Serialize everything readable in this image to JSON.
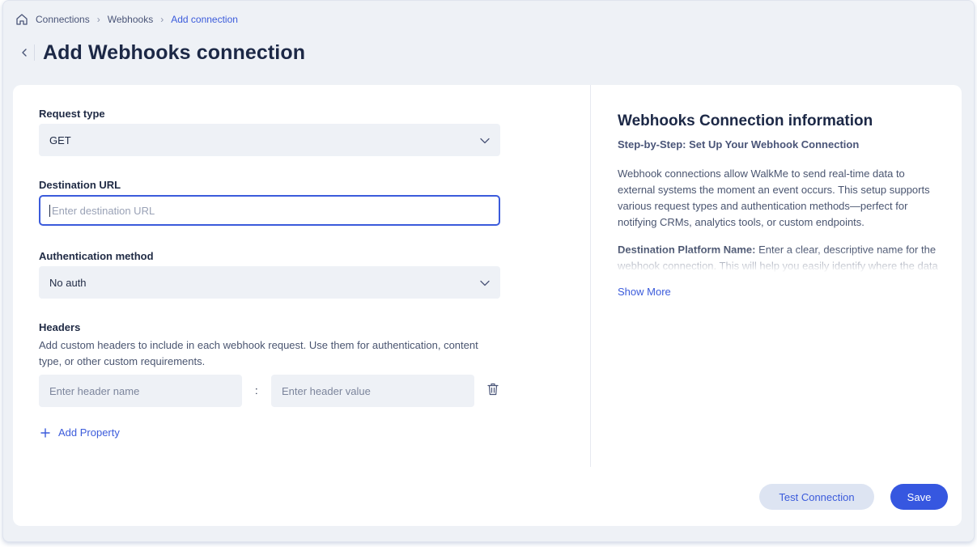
{
  "breadcrumb": {
    "items": [
      "Connections",
      "Webhooks",
      "Add connection"
    ]
  },
  "header": {
    "title": "Add Webhooks connection"
  },
  "form": {
    "request_type": {
      "label": "Request type",
      "value": "GET"
    },
    "destination_url": {
      "label": "Destination URL",
      "placeholder": "Enter destination URL"
    },
    "auth_method": {
      "label": "Authentication method",
      "value": "No auth"
    },
    "headers": {
      "label": "Headers",
      "help": "Add custom headers to include in each webhook request. Use them for authentication, content type, or other custom requirements.",
      "name_placeholder": "Enter header name",
      "separator": ":",
      "value_placeholder": "Enter header value"
    },
    "add_property_label": "Add Property"
  },
  "info": {
    "title": "Webhooks Connection information",
    "subtitle": "Step-by-Step: Set Up Your Webhook Connection",
    "paragraph": "Webhook connections allow WalkMe to send real-time data to external systems the moment an event occurs. This setup supports various request types and authentication methods—perfect for notifying CRMs, analytics tools, or custom endpoints.",
    "field_name": "Destination Platform Name:",
    "field_desc": "Enter a clear, descriptive name for the webhook connection. This will help you easily identify where the data is being sent.",
    "show_more": "Show More"
  },
  "actions": {
    "test_label": "Test Connection",
    "save_label": "Save"
  },
  "colors": {
    "accent": "#3b5bdb",
    "save_bg": "#3657e0",
    "test_bg": "#dde4f2",
    "page_bg": "#eef1f6"
  }
}
